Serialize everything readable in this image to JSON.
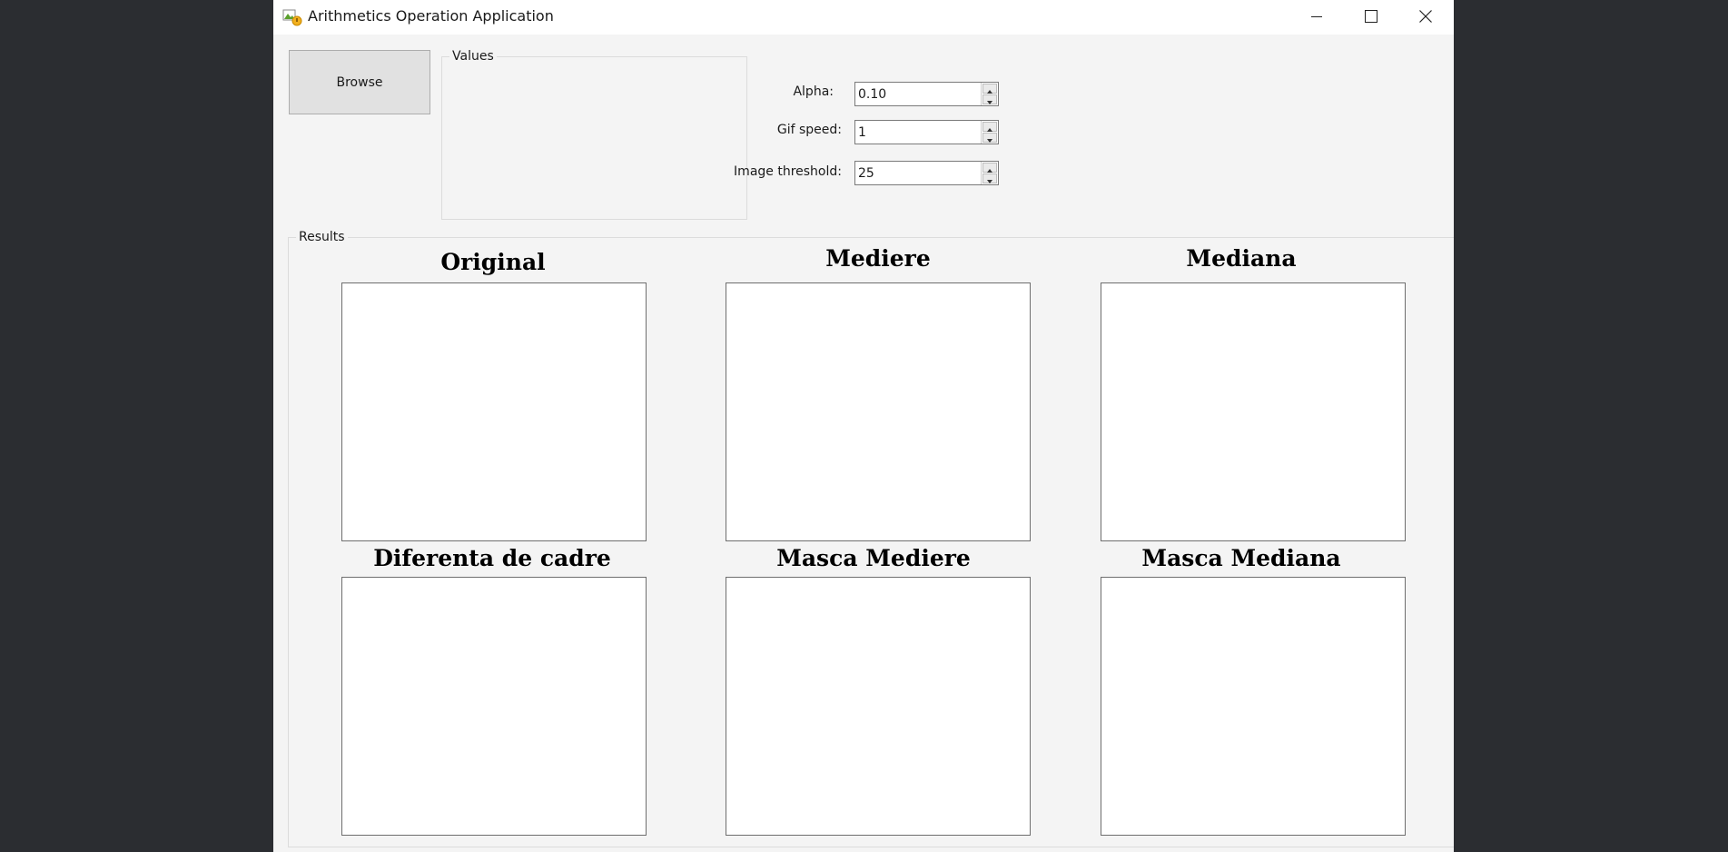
{
  "window": {
    "title": "Arithmetics Operation Application"
  },
  "toolbar": {
    "browse_label": "Browse"
  },
  "values": {
    "group_label": "Values",
    "alpha": {
      "label": "Alpha:",
      "value": "0.10"
    },
    "gif_speed": {
      "label": "Gif speed:",
      "value": "1"
    },
    "image_threshold": {
      "label": "Image threshold:",
      "value": "25"
    }
  },
  "results": {
    "group_label": "Results",
    "panels": [
      {
        "title": "Original"
      },
      {
        "title": "Mediere"
      },
      {
        "title": "Mediana"
      },
      {
        "title": "Diferenta de cadre"
      },
      {
        "title": "Masca Mediere"
      },
      {
        "title": "Masca Mediana"
      }
    ]
  },
  "icons": {
    "app": "app-image-icon",
    "minimize": "minimize-icon",
    "maximize": "maximize-icon",
    "close": "close-icon",
    "spin_up": "spin-up-arrow-icon",
    "spin_down": "spin-down-arrow-icon"
  },
  "colors": {
    "desktop_bg": "#2b2d31",
    "window_bg": "#f4f4f4",
    "titlebar_bg": "#ffffff",
    "button_bg": "#e1e1e1",
    "picture_bg": "#ffffff"
  }
}
